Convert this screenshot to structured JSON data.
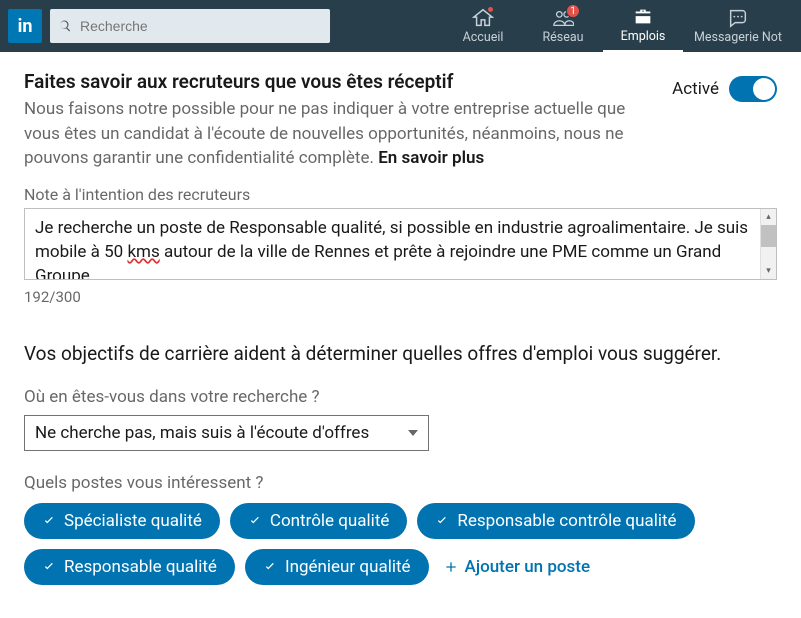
{
  "logo_text": "in",
  "search": {
    "placeholder": "Recherche"
  },
  "nav": {
    "home": "Accueil",
    "network": "Réseau",
    "jobs": "Emplois",
    "messaging": "Messagerie Not",
    "network_badge": "1"
  },
  "open": {
    "title": "Faites savoir aux recruteurs que vous êtes réceptif",
    "body_pre": "Nous faisons notre possible pour ne pas indiquer à votre entreprise actuelle que vous êtes un candidat à l'écoute de nouvelles opportunités, néanmoins, nous ne pouvons garantir une confidentialité complète. ",
    "learn_more": "En savoir plus",
    "toggle_label": "Activé"
  },
  "note": {
    "label": "Note à l'intention des recruteurs",
    "line1_pre": "Je recherche un poste de Responsable qualité, si possible en industrie agroalimentaire. Je suis mobile à 50 ",
    "line1_red": "kms",
    "line1_post": " autour de la ville de Rennes et prête à rejoindre une PME comme un Grand Groupe.",
    "counter": "192/300"
  },
  "career": {
    "heading": "Vos objectifs de carrière aident à déterminer quelles offres d'emploi vous suggérer.",
    "status_label": "Où en êtes-vous dans votre recherche ?",
    "status_value": "Ne cherche pas, mais suis à l'écoute d'offres",
    "positions_label": "Quels postes vous intéressent ?",
    "pills": [
      "Spécialiste qualité",
      "Contrôle qualité",
      "Responsable contrôle qualité",
      "Responsable qualité",
      "Ingénieur qualité"
    ],
    "add_position": "Ajouter un poste"
  }
}
